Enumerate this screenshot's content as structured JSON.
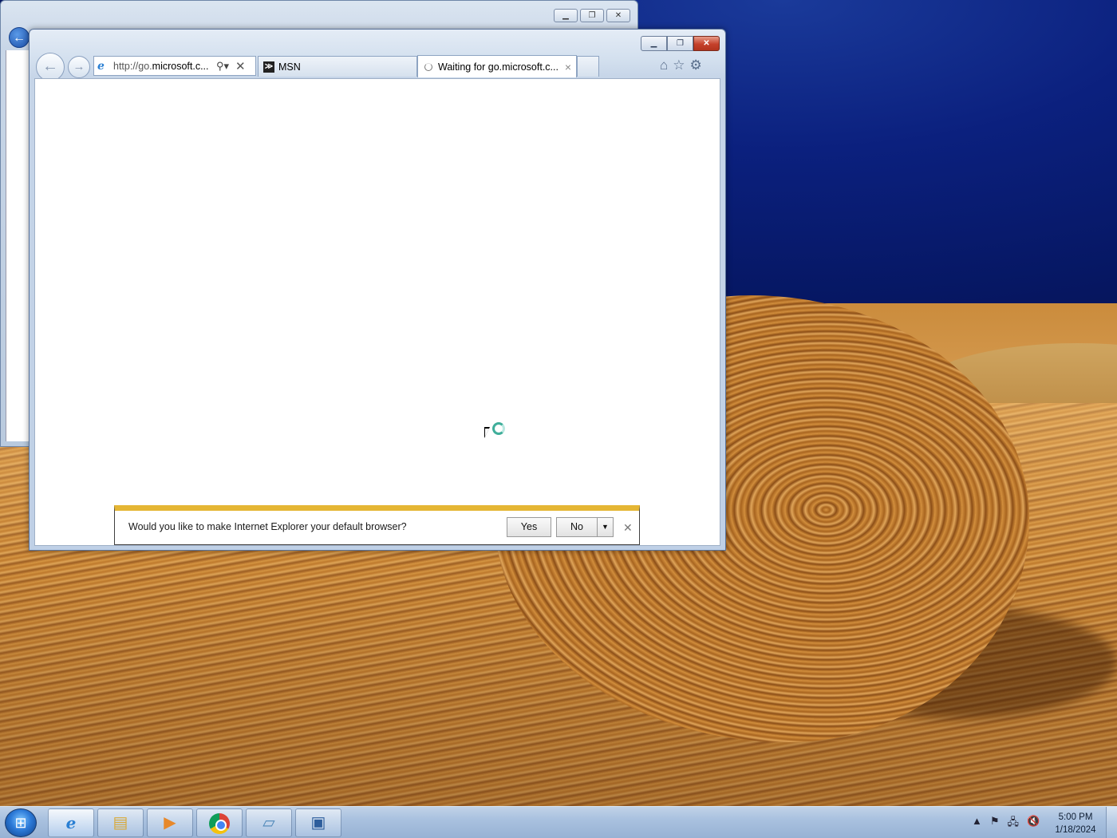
{
  "browser": {
    "address_url_plain": "http://go.",
    "address_url_bold": "microsoft.c...",
    "tabs": [
      {
        "label": "MSN",
        "icon": "msn-icon",
        "state": "inactive"
      },
      {
        "label": "Waiting for go.microsoft.c...",
        "icon": "loading-spinner-icon",
        "state": "active",
        "close": "×"
      }
    ],
    "tool_icons": [
      "home-icon",
      "favorites-star-icon",
      "gear-icon"
    ]
  },
  "notification": {
    "message": "Would you like to make Internet Explorer your default browser?",
    "yes_label": "Yes",
    "no_label": "No",
    "accent_color": "#e5b634"
  },
  "taskbar": {
    "items": [
      "internet-explorer-icon",
      "file-explorer-icon",
      "media-player-icon",
      "chrome-icon",
      "app-icon",
      "remote-desktop-icon"
    ],
    "clock": {
      "time": "5:00 PM",
      "date": "1/18/2024"
    }
  }
}
